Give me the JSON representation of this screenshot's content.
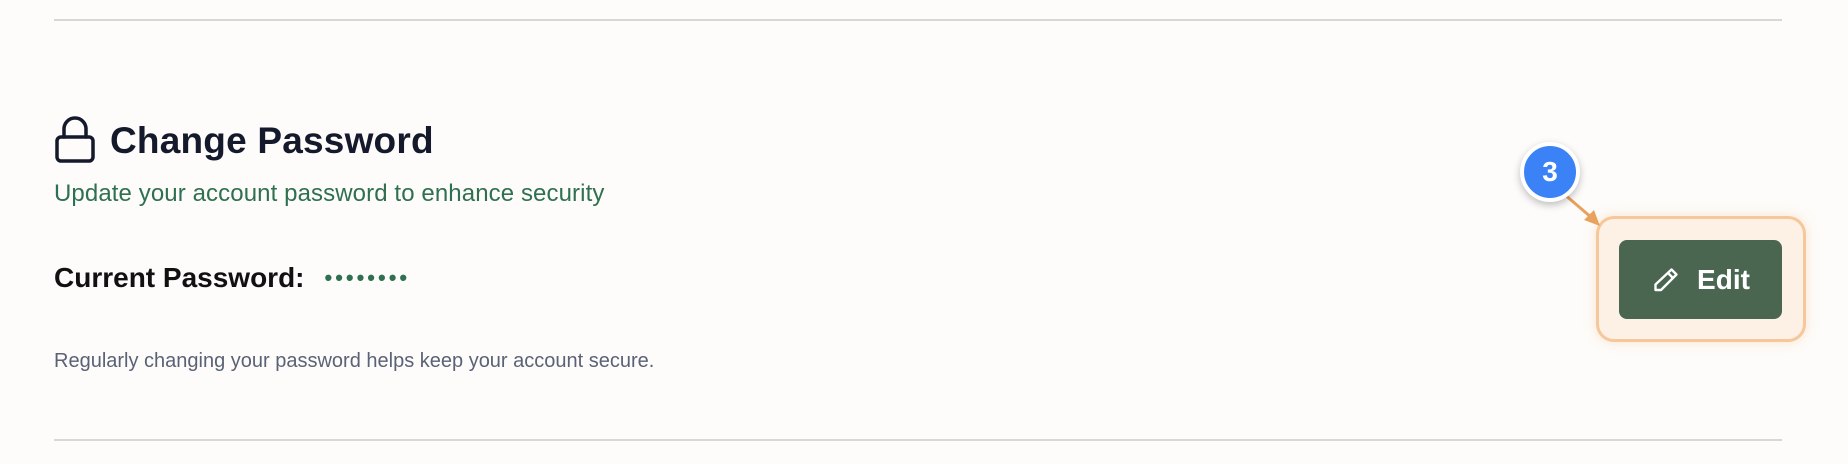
{
  "section": {
    "title": "Change Password",
    "subtitle": "Update your account password to enhance security",
    "icon": "lock-icon"
  },
  "password": {
    "label": "Current Password:",
    "mask": "••••••••"
  },
  "help_text": "Regularly changing your password helps keep your account secure.",
  "edit_button": {
    "label": "Edit",
    "icon": "pencil-icon"
  },
  "annotation": {
    "step_number": "3"
  },
  "colors": {
    "accent_green": "#2f7050",
    "button_bg": "#4a6650",
    "badge_blue": "#3b82f6",
    "highlight_orange": "#f6c79a"
  }
}
